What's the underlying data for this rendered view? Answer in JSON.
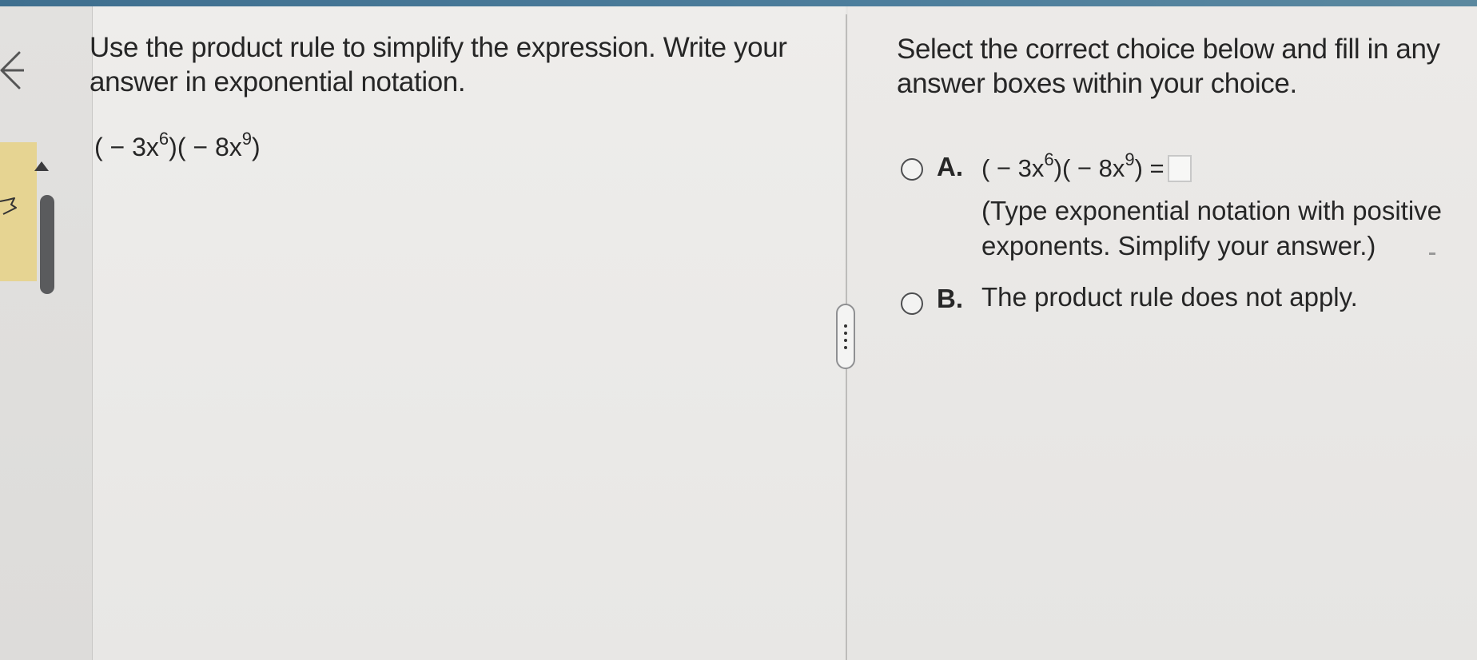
{
  "question": {
    "line1": "Use the product rule to simplify the expression. Write your",
    "line2": "answer in exponential notation.",
    "expression": {
      "open": "( − 3x",
      "exp1": "6",
      "mid": ")( − 8x",
      "exp2": "9",
      "close": ")"
    }
  },
  "instructions": {
    "line1": "Select the correct choice below and fill in any",
    "line2": "answer boxes within your choice."
  },
  "choices": [
    {
      "letter": "A.",
      "expression": {
        "open": "( − 3x",
        "exp1": "6",
        "mid": ")( − 8x",
        "exp2": "9",
        "close": ") ="
      },
      "answer_value": "",
      "hint_line1": "(Type exponential notation with positive",
      "hint_line2": "exponents. Simplify your answer.)"
    },
    {
      "letter": "B.",
      "text": "The product rule does not apply."
    }
  ],
  "colors": {
    "accent_strip": "#4d7e9c",
    "tab_highlight": "#e6d492",
    "text": "#262626"
  },
  "icons": [
    "back-arrow-icon",
    "navigation-icon",
    "scroll-up-icon",
    "more-options-icon"
  ]
}
